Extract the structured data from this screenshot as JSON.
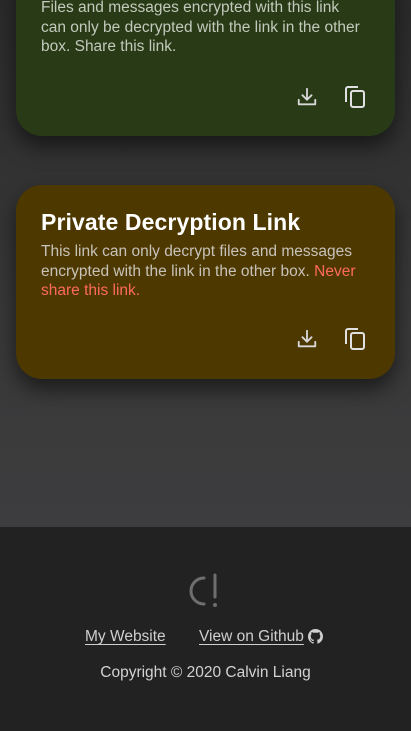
{
  "public_card": {
    "description": "Files and messages encrypted with this link can only be decrypted with the link in the other box. Share this link.",
    "color": "#283b16"
  },
  "private_card": {
    "title": "Private Decryption Link",
    "description": "This link can only decrypt files and messages encrypted with the link in the other box.",
    "warning": "Never share this link.",
    "color": "#4d3800",
    "warning_color": "#ff6a5c"
  },
  "icons": {
    "download": "download-icon",
    "copy": "copy-icon",
    "logo": "logo-icon",
    "github": "github-icon"
  },
  "footer": {
    "website_link": "My Website",
    "github_link": "View on Github",
    "copyright": "Copyright © 2020 Calvin Liang"
  }
}
